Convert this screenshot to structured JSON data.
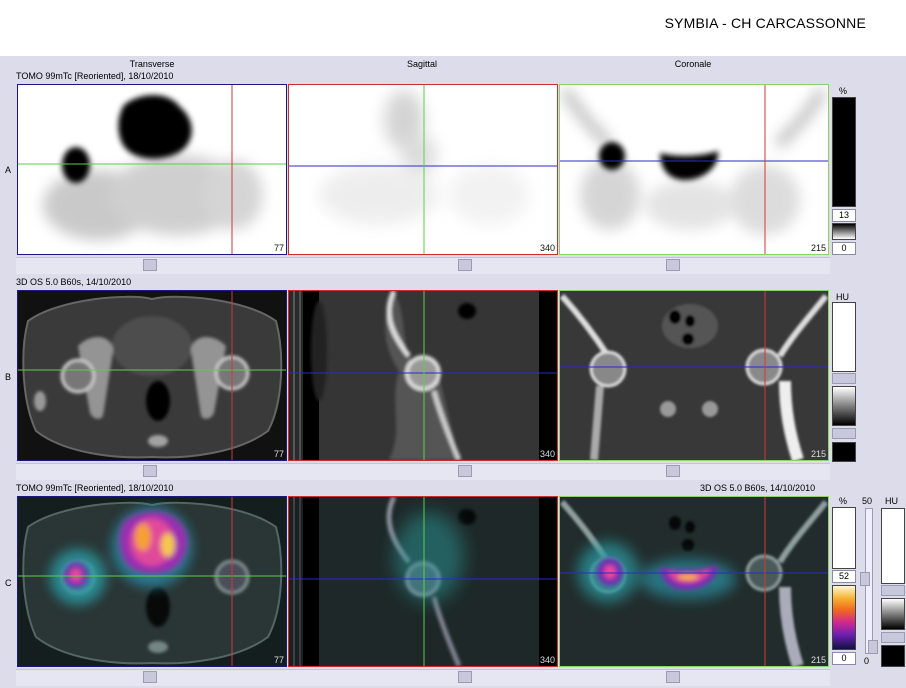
{
  "header": {
    "site": "SYMBIA - CH CARCASSONNE"
  },
  "columns": [
    "Transverse",
    "Sagittal",
    "Coronale"
  ],
  "rows": [
    {
      "label": "A",
      "series": "TOMO 99mTc [Reoriented], 18/10/2010",
      "slices": [
        "77",
        "340",
        "215"
      ],
      "scale": {
        "unit": "%",
        "value": "13",
        "min": "0"
      }
    },
    {
      "label": "B",
      "series": "3D  OS  5.0  B60s, 14/10/2010",
      "slices": [
        "77",
        "340",
        "215"
      ],
      "scale": {
        "unit": "HU"
      }
    },
    {
      "label": "C",
      "series_left": "TOMO 99mTc [Reoriented], 18/10/2010",
      "series_right": "3D  OS  5.0  B60s, 14/10/2010",
      "slices": [
        "77",
        "340",
        "215"
      ],
      "scale": {
        "unit": "%",
        "value": "52",
        "min": "0",
        "slider_value": "50",
        "slider_min": "0",
        "unit2": "HU"
      }
    }
  ],
  "colors": {
    "frame_transverse": "#1a1a80",
    "frame_sagittal": "#c83030",
    "frame_coronal": "#8fd06a",
    "crosshair_green": "#59d04a",
    "crosshair_red": "#d03a3a",
    "crosshair_blue": "#2a2ad0"
  }
}
